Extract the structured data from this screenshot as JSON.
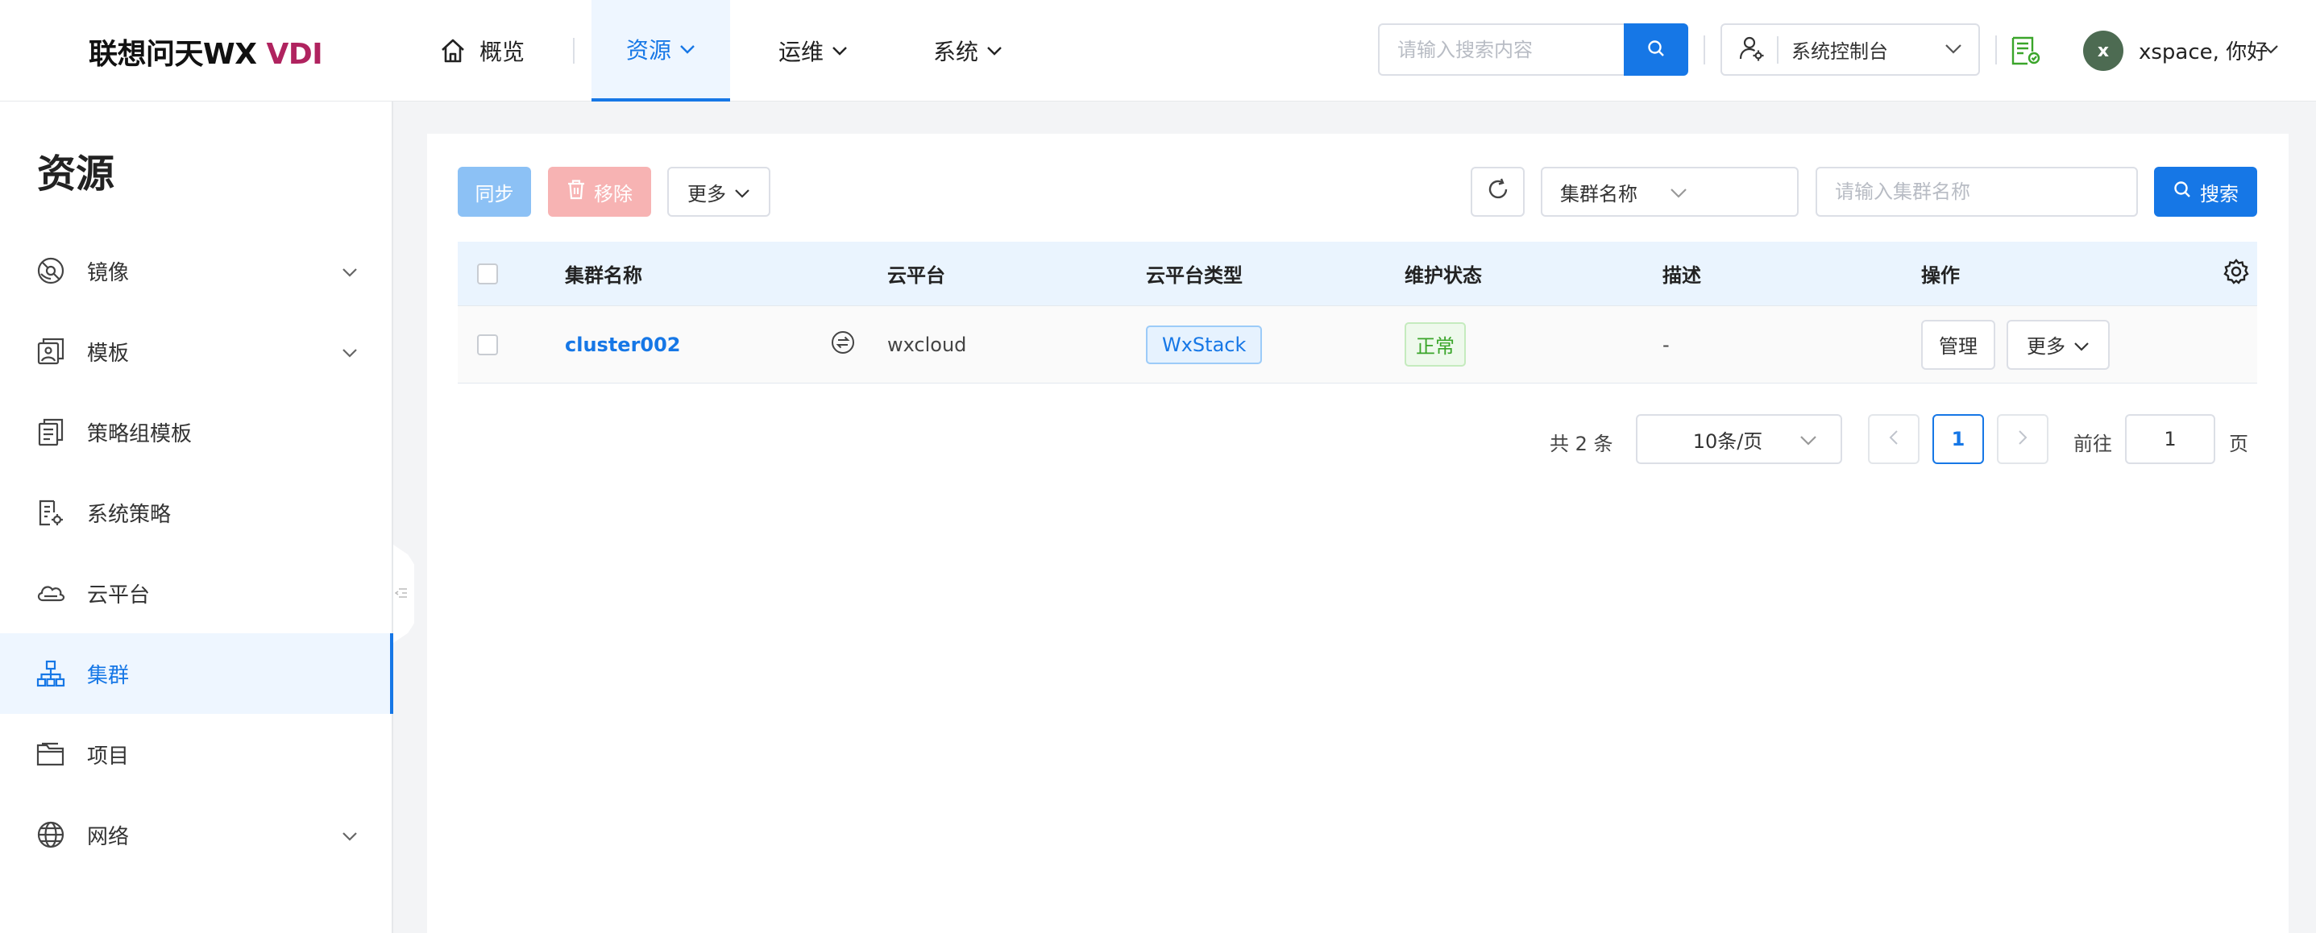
{
  "brand": {
    "logo_main": "联想问天WX ",
    "logo_accent": "VDI",
    "accent_color": "#b0235f"
  },
  "nav": {
    "overview": "概览",
    "resources": "资源",
    "operations": "运维",
    "system": "系统"
  },
  "header": {
    "search_placeholder": "请输入搜索内容",
    "console_label": "系统控制台",
    "avatar_letter": "x",
    "user_greeting": "xspace, 你好"
  },
  "sidebar": {
    "title": "资源",
    "items": [
      {
        "label": "镜像",
        "icon": "image-icon",
        "expandable": true
      },
      {
        "label": "模板",
        "icon": "template-icon",
        "expandable": true
      },
      {
        "label": "策略组模板",
        "icon": "policy-group-icon",
        "expandable": false
      },
      {
        "label": "系统策略",
        "icon": "system-policy-icon",
        "expandable": false
      },
      {
        "label": "云平台",
        "icon": "cloud-icon",
        "expandable": false
      },
      {
        "label": "集群",
        "icon": "cluster-icon",
        "expandable": false,
        "active": true
      },
      {
        "label": "项目",
        "icon": "folder-icon",
        "expandable": false
      },
      {
        "label": "网络",
        "icon": "globe-icon",
        "expandable": true
      }
    ]
  },
  "toolbar": {
    "sync": "同步",
    "remove": "移除",
    "more": "更多",
    "filter_field": "集群名称",
    "filter_placeholder": "请输入集群名称",
    "search": "搜索"
  },
  "table": {
    "columns": [
      "集群名称",
      "云平台",
      "云平台类型",
      "维护状态",
      "描述",
      "操作"
    ],
    "rows": [
      {
        "name": "cluster002",
        "platform": "wxcloud",
        "platform_type": "WxStack",
        "status": "正常",
        "description": "-",
        "actions": {
          "manage": "管理",
          "more": "更多"
        }
      }
    ]
  },
  "pagination": {
    "total": "共 2 条",
    "page_size": "10条/页",
    "current_page": "1",
    "goto_label": "前往",
    "goto_value": "1",
    "page_label": "页"
  },
  "colors": {
    "primary": "#1677e6",
    "danger_light": "#f7b3b3",
    "success": "#3aa52a"
  }
}
